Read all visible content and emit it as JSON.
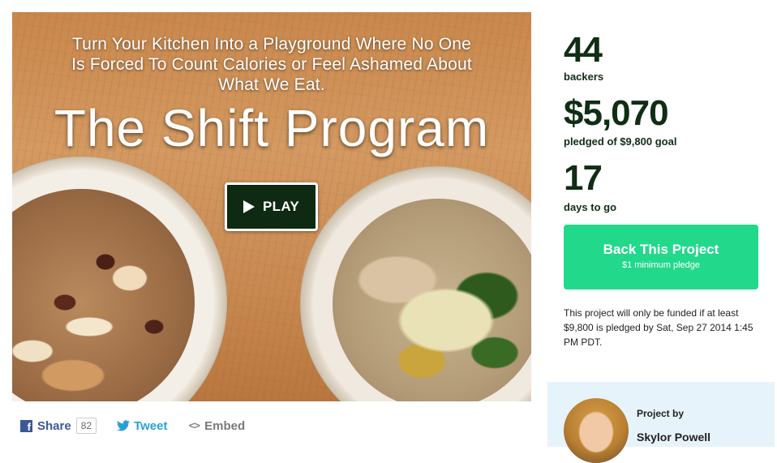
{
  "video": {
    "tagline_lines": [
      "Turn Your Kitchen Into a Playground Where No One",
      "Is Forced To Count Calories or Feel Ashamed About",
      "What We Eat."
    ],
    "title": "The Shift Program",
    "play_label": "PLAY"
  },
  "share": {
    "facebook_label": "Share",
    "facebook_count": "82",
    "tweet_label": "Tweet",
    "embed_label": "Embed"
  },
  "stats": {
    "backers": "44",
    "backers_label": "backers",
    "pledged": "$5,070",
    "pledged_label": "pledged of $9,800 goal",
    "days": "17",
    "days_label": "days to go"
  },
  "back_button": {
    "label": "Back This Project",
    "sublabel": "$1 minimum pledge"
  },
  "funding_note": "This project will only be funded if at least $9,800 is pledged by Sat, Sep 27 2014 1:45 PM PDT.",
  "creator": {
    "project_by_label": "Project by",
    "name": "Skylor Powell"
  },
  "colors": {
    "accent_green": "#22d98b",
    "stat_text": "#0f2e14",
    "play_button_bg": "#0e2a12",
    "facebook_blue": "#3b5998",
    "twitter_blue": "#2a9fd6",
    "creator_card_bg": "#e7f3fb"
  },
  "icons": [
    "play-icon",
    "facebook-icon",
    "twitter-bird-icon",
    "embed-code-icon"
  ]
}
